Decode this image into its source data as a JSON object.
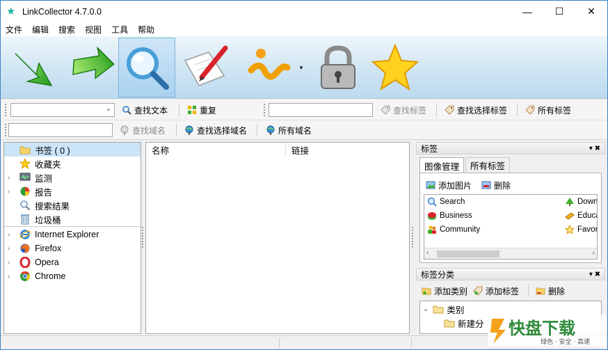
{
  "window": {
    "title": "LinkCollector 4.7.0.0",
    "minimize": "—",
    "maximize": "☐",
    "close": "✕"
  },
  "menu": [
    "文件",
    "编辑",
    "搜索",
    "视图",
    "工具",
    "帮助"
  ],
  "big_toolbar": {
    "buttons": [
      "arrow-down-green-icon",
      "arrow-up-green-icon",
      "magnifier-search-icon",
      "paper-pen-icon",
      "info-i-icon",
      "padlock-icon",
      "star-favorite-icon"
    ],
    "active_index": 2
  },
  "toolbar1": {
    "search_combo_value": "",
    "find_text": "查找文本",
    "repeat": "重复",
    "tag_input_value": "",
    "find_tag": "查找标签",
    "find_selected_tag": "查找选择标签",
    "all_tags": "所有标签"
  },
  "toolbar2": {
    "domain_input_value": "",
    "find_domain": "查找域名",
    "find_selected_domain": "查找选择域名",
    "all_domains": "所有域名"
  },
  "left_tree": {
    "items": [
      {
        "label": "书签 ( 0 )",
        "icon": "folder-icon"
      },
      {
        "label": "收藏夹",
        "icon": "star-icon"
      },
      {
        "label": "监测",
        "icon": "monitor-icon"
      },
      {
        "label": "报告",
        "icon": "pie-chart-icon"
      },
      {
        "label": "搜索结果",
        "icon": "search-icon"
      },
      {
        "label": "垃圾桶",
        "icon": "trash-icon"
      }
    ],
    "browsers": [
      {
        "label": "Internet Explorer",
        "icon": "internet-explorer-icon"
      },
      {
        "label": "Firefox",
        "icon": "firefox-icon"
      },
      {
        "label": "Opera",
        "icon": "opera-icon"
      },
      {
        "label": "Chrome",
        "icon": "chrome-icon"
      }
    ]
  },
  "list": {
    "columns": [
      "名称",
      "链接"
    ]
  },
  "tags_panel": {
    "title": "标签",
    "tabs": [
      "图像管理",
      "所有标签"
    ],
    "add_image": "添加图片",
    "delete": "删除",
    "items_left": [
      "Search",
      "Business",
      "Community"
    ],
    "items_right": [
      "Down",
      "Educa",
      "Favor"
    ]
  },
  "category_panel": {
    "title": "标签分类",
    "add_category": "添加类别",
    "add_tag": "添加标签",
    "delete": "删除",
    "root": "类别",
    "child": "新建分"
  },
  "watermark": {
    "big": "快盘下载",
    "small": "绿色 · 安全 · 高速"
  },
  "colors": {
    "accent": "#3b7fc4",
    "selection": "#cce4f7",
    "toolbar_bg": "#cfe5f3"
  }
}
